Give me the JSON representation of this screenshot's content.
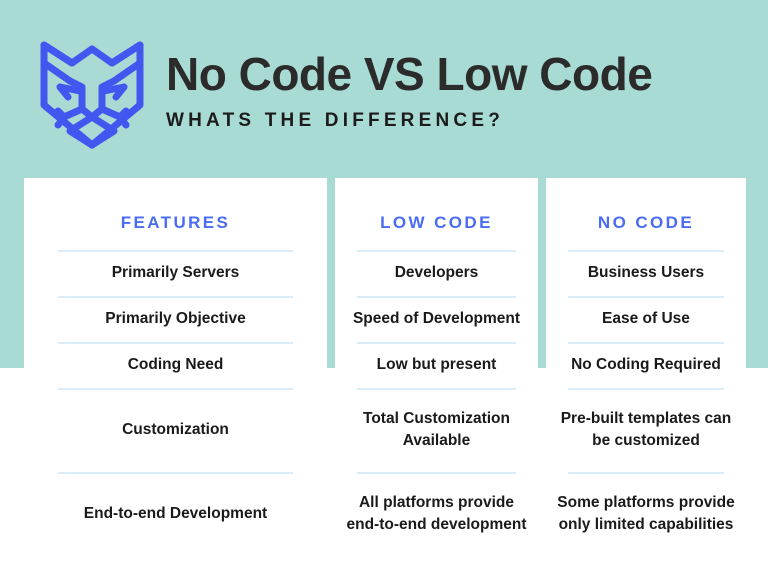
{
  "header": {
    "title": "No Code VS Low Code",
    "subtitle": "WHATS THE DIFFERENCE?",
    "logo_icon": "lion-head-logo-icon"
  },
  "colors": {
    "background_teal": "#a9dbd5",
    "accent_blue": "#4a6cf5",
    "divider_blue": "#d8ecfa",
    "text_dark": "#1a1a1a",
    "card_white": "#ffffff"
  },
  "table": {
    "headers": [
      "FEATURES",
      "LOW CODE",
      "NO CODE"
    ],
    "rows": [
      {
        "feature": "Primarily Servers",
        "low_code": "Developers",
        "no_code": "Business Users"
      },
      {
        "feature": "Primarily Objective",
        "low_code": "Speed of Development",
        "no_code": "Ease of Use"
      },
      {
        "feature": "Coding Need",
        "low_code": "Low but present",
        "no_code": "No Coding Required"
      },
      {
        "feature": "Customization",
        "low_code": "Total Customization Available",
        "no_code": "Pre-built templates can be customized"
      },
      {
        "feature": "End-to-end Development",
        "low_code": "All platforms provide end-to-end development",
        "no_code": "Some platforms provide only limited capabilities"
      }
    ]
  }
}
